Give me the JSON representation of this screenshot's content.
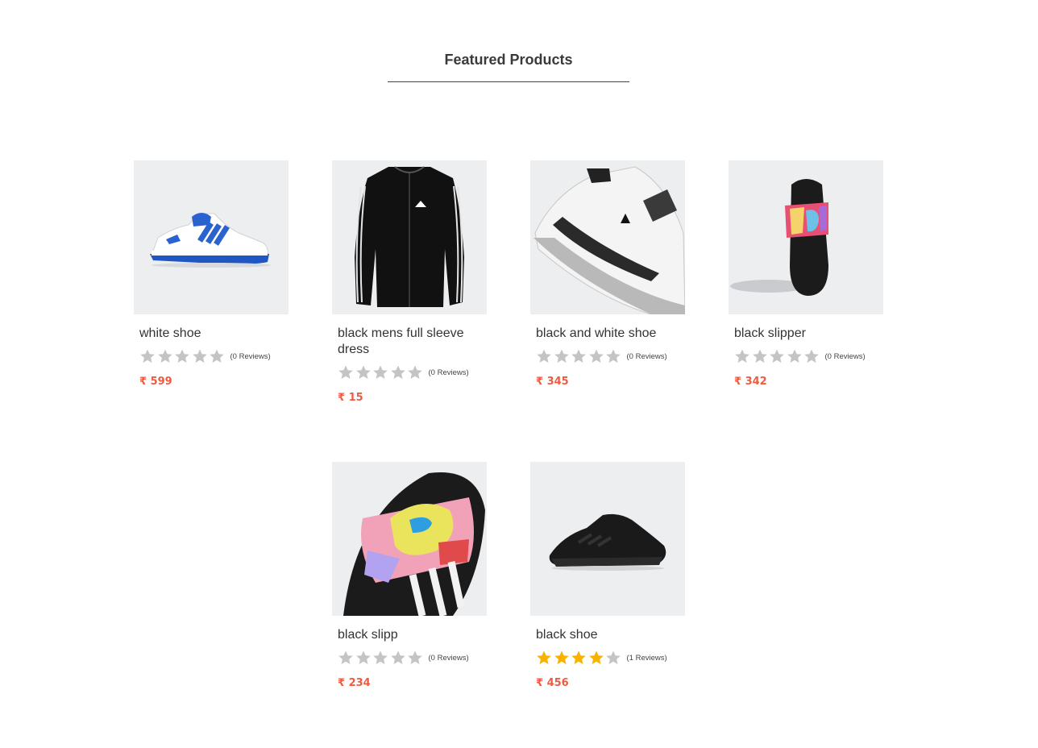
{
  "section": {
    "title": "Featured Products"
  },
  "colors": {
    "price": "#ef5b41",
    "star_filled": "#f9b200",
    "star_empty": "#c4c4c4",
    "image_bg": "#eceeef"
  },
  "currency_symbol": "₹",
  "products": [
    {
      "name": "white shoe",
      "rating": 0,
      "reviews_label": "(0 Reviews)",
      "price": "599",
      "image_icon": "white-blue-sneaker-image"
    },
    {
      "name": "black mens full sleeve dress",
      "rating": 0,
      "reviews_label": "(0 Reviews)",
      "price": "15",
      "image_icon": "black-track-jacket-image"
    },
    {
      "name": "black and white shoe",
      "rating": 0,
      "reviews_label": "(0 Reviews)",
      "price": "345",
      "image_icon": "black-white-sneaker-image"
    },
    {
      "name": "black slipper",
      "rating": 0,
      "reviews_label": "(0 Reviews)",
      "price": "342",
      "image_icon": "black-slide-image"
    },
    {
      "name": "black slipp",
      "rating": 0,
      "reviews_label": "(0 Reviews)",
      "price": "234",
      "image_icon": "black-slide-closeup-image"
    },
    {
      "name": "black shoe",
      "rating": 4,
      "reviews_label": "(1 Reviews)",
      "price": "456",
      "image_icon": "black-running-shoe-image"
    }
  ]
}
